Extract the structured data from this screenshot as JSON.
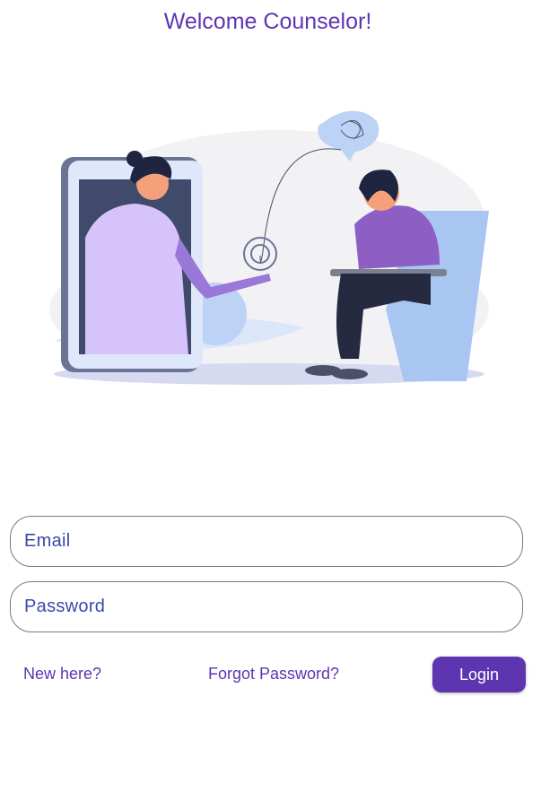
{
  "header": {
    "title": "Welcome Counselor!"
  },
  "illustration": {
    "icon": "counseling-illustration"
  },
  "form": {
    "email_placeholder": "Email",
    "email_value": "",
    "password_placeholder": "Password",
    "password_value": "",
    "new_here_label": "New here?",
    "forgot_password_label": "Forgot Password?",
    "login_label": "Login"
  },
  "colors": {
    "accent": "#5e35b1",
    "placeholder": "#3949ab",
    "border": "#7a7a80"
  }
}
